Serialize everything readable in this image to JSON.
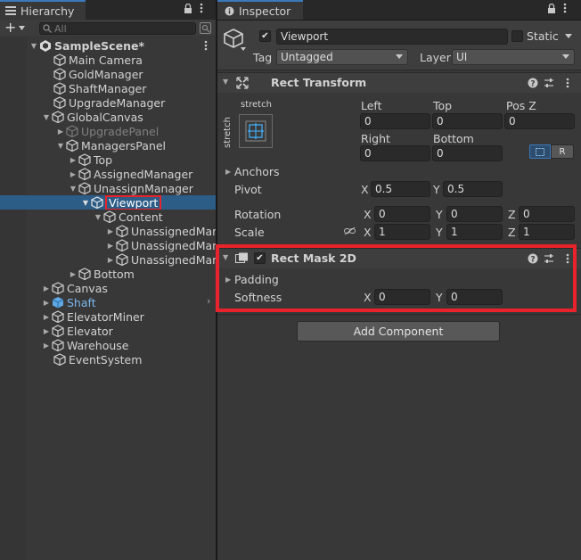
{
  "hierarchy": {
    "tab_title": "Hierarchy",
    "search_placeholder": "All",
    "scene_name": "SampleScene*",
    "items": [
      {
        "label": "Main Camera"
      },
      {
        "label": "GoldManager"
      },
      {
        "label": "ShaftManager"
      },
      {
        "label": "UpgradeManager"
      },
      {
        "label": "GlobalCanvas"
      },
      {
        "label": "UpgradePanel"
      },
      {
        "label": "ManagersPanel"
      },
      {
        "label": "Top"
      },
      {
        "label": "AssignedManager"
      },
      {
        "label": "UnassignManager"
      },
      {
        "label": "Viewport"
      },
      {
        "label": "Content"
      },
      {
        "label": "UnassignedMana"
      },
      {
        "label": "UnassignedMan"
      },
      {
        "label": "UnassignedMan"
      },
      {
        "label": "Bottom"
      },
      {
        "label": "Canvas"
      },
      {
        "label": "Shaft"
      },
      {
        "label": "ElevatorMiner"
      },
      {
        "label": "Elevator"
      },
      {
        "label": "Warehouse"
      },
      {
        "label": "EventSystem"
      }
    ]
  },
  "inspector": {
    "tab_title": "Inspector",
    "object_name": "Viewport",
    "static_label": "Static",
    "tag_label": "Tag",
    "tag_value": "Untagged",
    "layer_label": "Layer",
    "layer_value": "UI",
    "rect_transform": {
      "title": "Rect Transform",
      "anchor_preset_top": "stretch",
      "anchor_preset_side": "stretch",
      "left_label": "Left",
      "left_value": "0",
      "top_label": "Top",
      "top_value": "0",
      "posz_label": "Pos Z",
      "posz_value": "0",
      "right_label": "Right",
      "right_value": "0",
      "bottom_label": "Bottom",
      "bottom_value": "0",
      "r_button": "R",
      "anchors_label": "Anchors",
      "pivot_label": "Pivot",
      "pivot_x": "0.5",
      "pivot_y": "0.5",
      "rotation_label": "Rotation",
      "rot_x": "0",
      "rot_y": "0",
      "rot_z": "0",
      "scale_label": "Scale",
      "scale_x": "1",
      "scale_y": "1",
      "scale_z": "1",
      "x_label": "X",
      "y_label": "Y",
      "z_label": "Z"
    },
    "rect_mask": {
      "title": "Rect Mask 2D",
      "padding_label": "Padding",
      "softness_label": "Softness",
      "softness_x": "0",
      "softness_y": "0",
      "x_label": "X",
      "y_label": "Y"
    },
    "add_component": "Add Component"
  },
  "colors": {
    "accent_selection": "#2c5d87",
    "highlight_red": "#e8232c",
    "tab_accent": "#3a79bb"
  }
}
